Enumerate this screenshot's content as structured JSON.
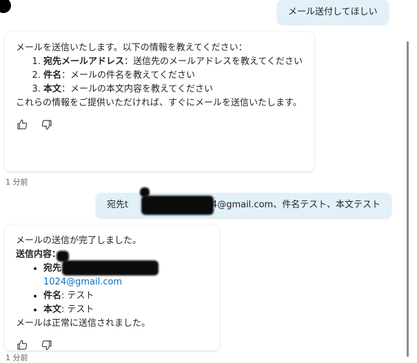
{
  "messages": {
    "user1": "メール送付してほしい",
    "bot1": {
      "intro": "メールを送信いたします。以下の情報を教えてください：",
      "items": [
        {
          "label": "宛先メールアドレス",
          "sep": "：",
          "text": "送信先のメールアドレスを教えてください"
        },
        {
          "label": "件名",
          "sep": "：",
          "text": "メールの件名を教えてください"
        },
        {
          "label": "本文",
          "sep": "：",
          "text": "メールの本文内容を教えてください"
        }
      ],
      "outro": "これらの情報をご提供いただければ、すぐにメールを送信いたします。"
    },
    "time1": "1 分前",
    "user2": {
      "prefix": "宛先t",
      "email_visible": "1024@gmail.com",
      "suffix": "、件名テスト、本文テスト"
    },
    "bot2": {
      "intro": "メールの送信が完了しました。",
      "heading": "送信内容：",
      "items": [
        {
          "label": "宛先",
          "sep": ": ",
          "text": "1024@gmail.com"
        },
        {
          "label": "件名",
          "sep": ": ",
          "text": "テスト"
        },
        {
          "label": "本文",
          "sep": ": ",
          "text": "テスト"
        }
      ],
      "outro": "メールは正常に送信されました。"
    },
    "time2": "1 分前"
  },
  "icons": {
    "like": "thumbs-up-icon",
    "dislike": "thumbs-down-icon"
  },
  "colors": {
    "user_bubble": "#e1f0f9",
    "link": "#0f6cbd"
  }
}
